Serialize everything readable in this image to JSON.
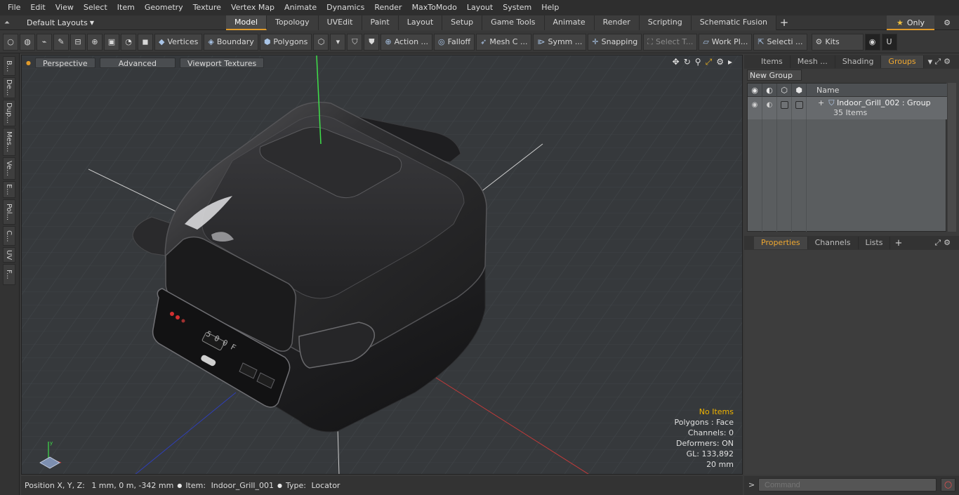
{
  "menu": [
    "File",
    "Edit",
    "View",
    "Select",
    "Item",
    "Geometry",
    "Texture",
    "Vertex Map",
    "Animate",
    "Dynamics",
    "Render",
    "MaxToModo",
    "Layout",
    "System",
    "Help"
  ],
  "layouts": {
    "label": "Default Layouts"
  },
  "tabs": [
    "Model",
    "Topology",
    "UVEdit",
    "Paint",
    "Layout",
    "Setup",
    "Game Tools",
    "Animate",
    "Render",
    "Scripting",
    "Schematic Fusion"
  ],
  "active_tab": "Model",
  "only_label": "Only",
  "toolbar": {
    "vertices": "Vertices",
    "boundary": "Boundary",
    "polygons": "Polygons",
    "action": "Action ...",
    "falloff": "Falloff",
    "mesh": "Mesh C ...",
    "symm": "Symm ...",
    "snapping": "Snapping",
    "select_t": "Select T...",
    "work_pl": "Work Pl...",
    "selecti": "Selecti ...",
    "kits": "Kits"
  },
  "left_strip": [
    "B...",
    "De...",
    "Dup...",
    "Mes...",
    "Ve...",
    "E...",
    "Pol...",
    "C...",
    "UV",
    "F..."
  ],
  "viewport": {
    "perspective": "Perspective",
    "advanced": "Advanced",
    "textures": "Viewport Textures",
    "hud": {
      "items": "No Items",
      "polygons": "Polygons : Face",
      "channels": "Channels: 0",
      "deformers": "Deformers: ON",
      "gl": "GL: 133,892",
      "scale": "20 mm"
    },
    "panel_readout": "5 0 0 F"
  },
  "panel_top": {
    "tabs": [
      "Items",
      "Mesh ...",
      "Shading",
      "Groups"
    ],
    "active": "Groups",
    "new_group": "New Group",
    "name_col": "Name",
    "group_name": "Indoor_Grill_002 : Group",
    "group_count": "35 Items"
  },
  "panel_bottom": {
    "tabs": [
      "Properties",
      "Channels",
      "Lists"
    ],
    "active": "Properties"
  },
  "command": {
    "placeholder": "Command"
  },
  "status": {
    "position_label": "Position X, Y, Z:",
    "position": "1 mm, 0 m, -342 mm",
    "item_label": "Item:",
    "item": "Indoor_Grill_001",
    "type_label": "Type:",
    "type": "Locator"
  },
  "colors": {
    "accent": "#e09a2a",
    "hud_warn": "#f0b400",
    "axis_y": "#3fe04a",
    "axis_x": "#c43a3a",
    "axis_z": "#2f3fb8"
  }
}
